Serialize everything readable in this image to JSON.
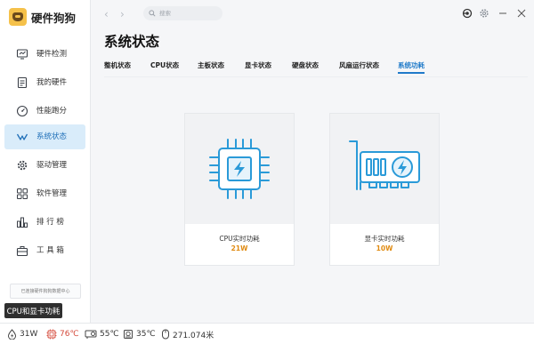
{
  "app": {
    "title": "硬件狗狗"
  },
  "search": {
    "placeholder": "搜索"
  },
  "sidebar": {
    "items": [
      {
        "label": "硬件检测",
        "icon": "hardware-check-icon"
      },
      {
        "label": "我的硬件",
        "icon": "my-hardware-icon"
      },
      {
        "label": "性能跑分",
        "icon": "benchmark-icon"
      },
      {
        "label": "系统状态",
        "icon": "system-status-icon",
        "active": true
      },
      {
        "label": "驱动管理",
        "icon": "driver-gear-icon"
      },
      {
        "label": "软件管理",
        "icon": "software-icon"
      },
      {
        "label": "排 行 榜",
        "icon": "ranking-icon"
      },
      {
        "label": "工 具 箱",
        "icon": "toolbox-icon"
      }
    ],
    "sync_text": "已连接硬件狗狗数据中心"
  },
  "tooltip": "CPU和显卡功耗",
  "main": {
    "title": "系统状态",
    "tabs": [
      {
        "label": "整机状态"
      },
      {
        "label": "CPU状态"
      },
      {
        "label": "主板状态"
      },
      {
        "label": "显卡状态"
      },
      {
        "label": "硬盘状态"
      },
      {
        "label": "风扇运行状态"
      },
      {
        "label": "系统功耗",
        "active": true
      }
    ],
    "cards": [
      {
        "label": "CPU实时功耗",
        "value": "21W",
        "icon": "cpu-chip-icon"
      },
      {
        "label": "显卡实时功耗",
        "value": "10W",
        "icon": "graphics-card-icon"
      }
    ]
  },
  "statusbar": {
    "power": "31W",
    "cpu_temp": "76℃",
    "gpu_temp": "55℃",
    "disk_temp": "35℃",
    "mouse_distance": "271.074米"
  },
  "colors": {
    "accent": "#1f7ac9",
    "active_bg": "#d9ecfa",
    "value": "#e08b12",
    "warning": "#d4493a",
    "icon_line": "#2a9ad8"
  }
}
